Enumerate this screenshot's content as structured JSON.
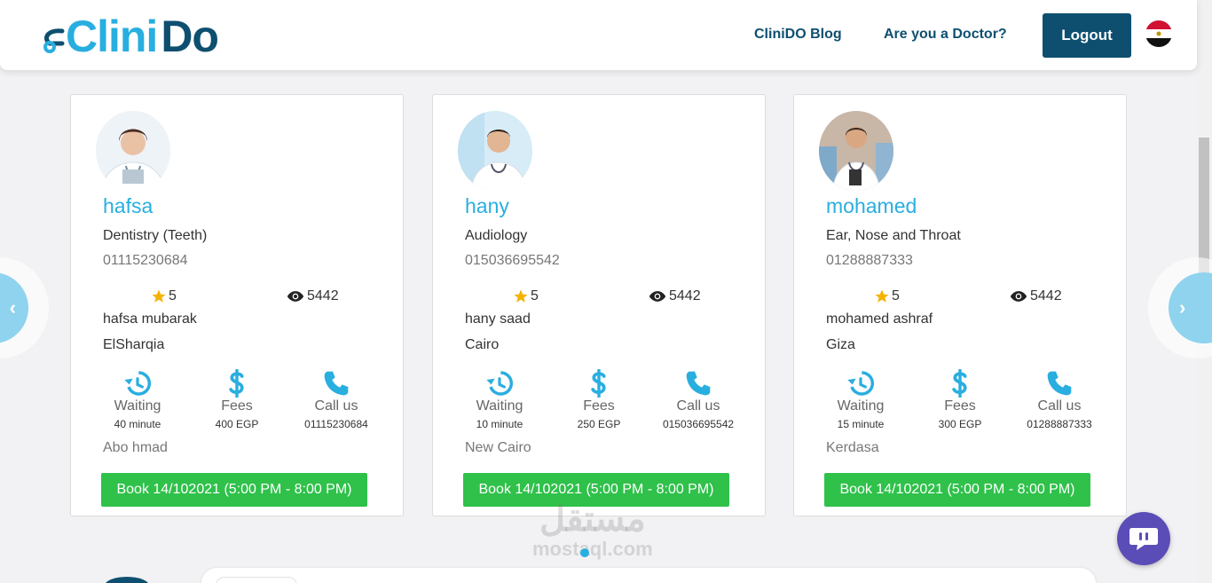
{
  "header": {
    "logo_part1": "Clini",
    "logo_part2": "Do",
    "blog_label": "CliniDO Blog",
    "doctor_label": "Are you a Doctor?",
    "logout_label": "Logout"
  },
  "carousel": {
    "prev_label": "‹",
    "next_label": "›"
  },
  "doctors": [
    {
      "name": "hafsa",
      "specialty": "Dentistry (Teeth)",
      "phone": "01115230684",
      "rating": "5",
      "views": "5442",
      "full_name": "hafsa mubarak",
      "city": "ElSharqia",
      "waiting_label": "Waiting",
      "waiting_value": "40 minute",
      "fees_label": "Fees",
      "fees_value": "400 EGP",
      "call_label": "Call us",
      "call_value": "01115230684",
      "area": "Abo hmad",
      "book_label": "Book 14/102021 (5:00 PM - 8:00 PM)"
    },
    {
      "name": "hany",
      "specialty": "Audiology",
      "phone": "015036695542",
      "rating": "5",
      "views": "5442",
      "full_name": "hany saad",
      "city": "Cairo",
      "waiting_label": "Waiting",
      "waiting_value": "10 minute",
      "fees_label": "Fees",
      "fees_value": "250 EGP",
      "call_label": "Call us",
      "call_value": "015036695542",
      "area": "New Cairo",
      "book_label": "Book 14/102021 (5:00 PM - 8:00 PM)"
    },
    {
      "name": "mohamed",
      "specialty": "Ear, Nose and Throat",
      "phone": "01288887333",
      "rating": "5",
      "views": "5442",
      "full_name": "mohamed ashraf",
      "city": "Giza",
      "waiting_label": "Waiting",
      "waiting_value": "15 minute",
      "fees_label": "Fees",
      "fees_value": "300 EGP",
      "call_label": "Call us",
      "call_value": "01288887333",
      "area": "Kerdasa",
      "book_label": "Book 14/102021 (5:00 PM - 8:00 PM)"
    }
  ],
  "watermark": {
    "arabic": "مستقل",
    "latin": "mostaql.com"
  },
  "colors": {
    "primary_dark": "#0e4f70",
    "primary_light": "#29aee0",
    "book_green": "#2fc14a",
    "chat_purple": "#5b4db7",
    "star_gold": "#f5b301"
  },
  "icons": [
    "history-icon",
    "dollar-icon",
    "phone-icon",
    "star-icon",
    "eye-icon",
    "chat-icon",
    "egypt-flag-icon"
  ]
}
